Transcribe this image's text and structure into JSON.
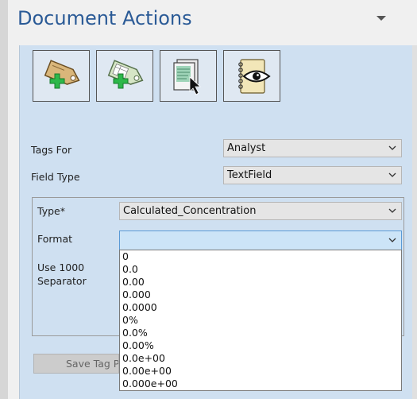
{
  "panel": {
    "title": "Document Actions"
  },
  "toolbar": {
    "buttons": [
      {
        "name": "add-tag-button",
        "icon": "add-tag-icon"
      },
      {
        "name": "add-table-tag-button",
        "icon": "add-table-tag-icon"
      },
      {
        "name": "select-document-button",
        "icon": "select-document-icon"
      },
      {
        "name": "view-notebook-button",
        "icon": "view-notebook-icon"
      }
    ]
  },
  "form": {
    "tags_for_label": "Tags For",
    "tags_for_value": "Analyst",
    "field_type_label": "Field Type",
    "field_type_value": "TextField",
    "type_label": "Type*",
    "type_value": "Calculated_Concentration",
    "format_label": "Format",
    "format_value": "",
    "separator_label_line1": "Use 1000",
    "separator_label_line2": "Separator",
    "save_label": "Save Tag Pa"
  },
  "format_options": [
    "0",
    "0.0",
    "0.00",
    "0.000",
    "0.0000",
    "0%",
    "0.0%",
    "0.00%",
    "0.0e+00",
    "0.00e+00",
    "0.000e+00"
  ],
  "colors": {
    "title": "#2a5a96",
    "panel_bg": "#cfe0f1",
    "focused_field": "#cce4f7",
    "focus_border": "#5a9ad6"
  }
}
